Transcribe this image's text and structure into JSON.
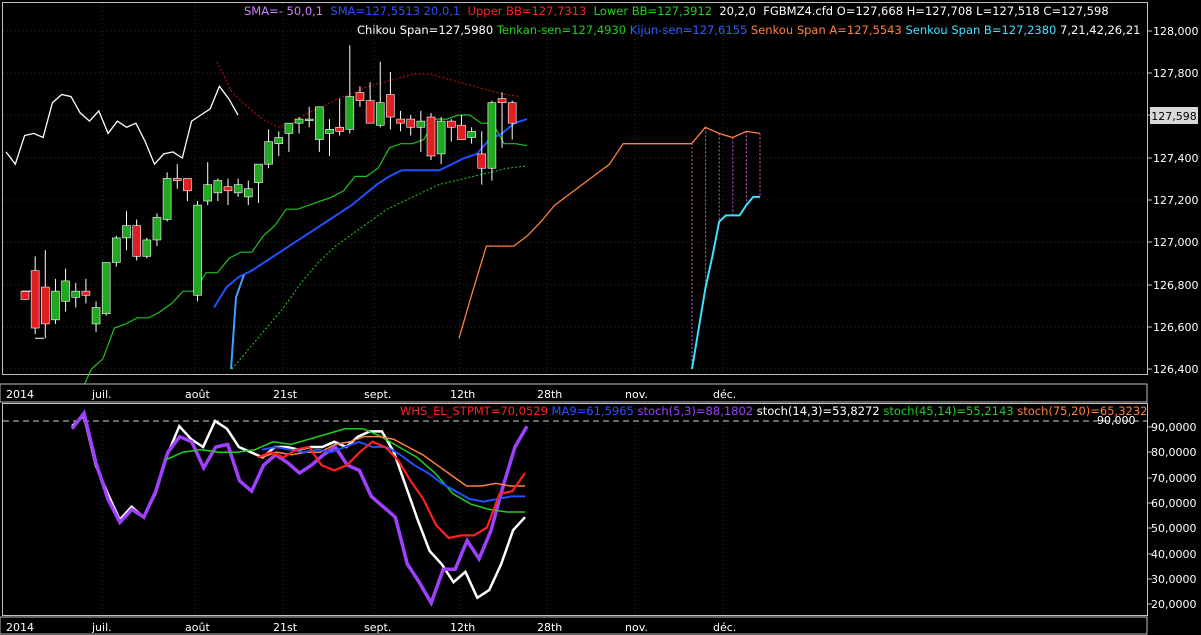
{
  "upper_panel": {
    "legend_row1": [
      {
        "text": "SMA=- 50,0,1",
        "color": "#d080ff"
      },
      {
        "text": "SMA=127,5513 20,0,1",
        "color": "#3050ff"
      },
      {
        "text": "Upper BB=127,7313",
        "color": "#ff2020"
      },
      {
        "text": "Lower BB=127,3912",
        "color": "#20d020"
      },
      {
        "text": "20,2,0",
        "color": "#ffffff"
      },
      {
        "text": "FGBMZ4.cfd O=127,668 H=127,708 L=127,518 C=127,598",
        "color": "#ffffff"
      }
    ],
    "legend_row2": [
      {
        "text": "Chikou Span=127,5980",
        "color": "#ffffff"
      },
      {
        "text": "Tenkan-sen=127,4930",
        "color": "#20d020"
      },
      {
        "text": "Kijun-sen=127,6155",
        "color": "#3060ff"
      },
      {
        "text": "Senkou Span A=127,5543",
        "color": "#ff8040"
      },
      {
        "text": "Senkou Span B=127,2380",
        "color": "#40e0ff"
      },
      {
        "text": "7,21,42,26,21",
        "color": "#ffffff"
      }
    ],
    "y_ticks": [
      "128,000",
      "127,800",
      "127,600",
      "127,400",
      "127,200",
      "127,000",
      "126,800",
      "126,600",
      "126,400"
    ],
    "last_price": "127,598",
    "x_ticks": [
      "2014",
      "juil.",
      "août",
      "21st",
      "sept.",
      "12th",
      "28th",
      "nov.",
      "déc."
    ]
  },
  "lower_panel": {
    "legend": [
      {
        "text": "WHS_EL_STPMT=70,0529",
        "color": "#ff2020"
      },
      {
        "text": "MA9=61,5965",
        "color": "#3050ff"
      },
      {
        "text": "stoch(5,3)=88,1802",
        "color": "#a040ff"
      },
      {
        "text": "stoch(14,3)=53,8272",
        "color": "#ffffff"
      },
      {
        "text": "stoch(45,14)=55,2143",
        "color": "#20d020"
      },
      {
        "text": "stoch(75,20)=65,3232",
        "color": "#ff8040"
      }
    ],
    "level_label": "90,000",
    "y_ticks": [
      "90,0000",
      "80,0000",
      "70,0000",
      "60,0000",
      "50,0000",
      "40,0000",
      "30,0000",
      "20,0000"
    ],
    "x_ticks": [
      "2014",
      "juil.",
      "août",
      "21st",
      "sept.",
      "12th",
      "28th",
      "nov.",
      "déc."
    ]
  },
  "chart_data": {
    "type": "line",
    "instrument": "FGBMZ4.cfd",
    "upper": {
      "ylim": [
        126.4,
        128.05
      ],
      "candles_ohlc": [
        [
          126.78,
          126.78,
          126.74,
          126.74
        ],
        [
          126.88,
          126.95,
          126.57,
          126.6
        ],
        [
          126.8,
          126.98,
          126.55,
          126.62
        ],
        [
          126.64,
          126.84,
          126.62,
          126.78
        ],
        [
          126.73,
          126.89,
          126.68,
          126.83
        ],
        [
          126.75,
          126.82,
          126.7,
          126.78
        ],
        [
          126.78,
          126.84,
          126.72,
          126.76
        ],
        [
          126.62,
          126.73,
          126.58,
          126.7
        ],
        [
          126.67,
          126.92,
          126.66,
          126.92
        ],
        [
          126.92,
          127.05,
          126.9,
          127.04
        ],
        [
          127.04,
          127.17,
          126.98,
          127.1
        ],
        [
          127.1,
          127.13,
          126.93,
          126.95
        ],
        [
          126.95,
          127.04,
          126.94,
          127.03
        ],
        [
          127.03,
          127.16,
          127.0,
          127.14
        ],
        [
          127.13,
          127.36,
          127.12,
          127.33
        ],
        [
          127.33,
          127.4,
          127.28,
          127.32
        ],
        [
          127.33,
          127.33,
          127.22,
          127.27
        ],
        [
          126.76,
          127.22,
          126.73,
          127.2
        ],
        [
          127.22,
          127.41,
          127.2,
          127.3
        ],
        [
          127.26,
          127.33,
          127.22,
          127.32
        ],
        [
          127.29,
          127.33,
          127.2,
          127.27
        ],
        [
          127.26,
          127.33,
          127.24,
          127.3
        ],
        [
          127.24,
          127.32,
          127.2,
          127.28
        ],
        [
          127.31,
          127.4,
          127.21,
          127.4
        ],
        [
          127.4,
          127.57,
          127.38,
          127.51
        ],
        [
          127.5,
          127.56,
          127.44,
          127.53
        ],
        [
          127.55,
          127.6,
          127.46,
          127.6
        ],
        [
          127.6,
          127.63,
          127.55,
          127.62
        ],
        [
          127.62,
          127.68,
          127.58,
          127.62
        ],
        [
          127.52,
          127.68,
          127.46,
          127.68
        ],
        [
          127.55,
          127.62,
          127.44,
          127.57
        ],
        [
          127.58,
          127.72,
          127.54,
          127.56
        ],
        [
          127.57,
          127.98,
          127.55,
          127.73
        ],
        [
          127.75,
          127.78,
          127.68,
          127.71
        ],
        [
          127.71,
          127.8,
          127.63,
          127.6
        ],
        [
          127.59,
          127.9,
          127.58,
          127.7
        ],
        [
          127.74,
          127.85,
          127.57,
          127.63
        ],
        [
          127.62,
          127.66,
          127.56,
          127.6
        ],
        [
          127.62,
          127.64,
          127.54,
          127.58
        ],
        [
          127.58,
          127.66,
          127.46,
          127.61
        ],
        [
          127.63,
          127.65,
          127.42,
          127.44
        ],
        [
          127.45,
          127.63,
          127.4,
          127.61
        ],
        [
          127.61,
          127.62,
          127.51,
          127.58
        ],
        [
          127.59,
          127.64,
          127.52,
          127.52
        ],
        [
          127.53,
          127.58,
          127.5,
          127.56
        ],
        [
          127.45,
          127.56,
          127.3,
          127.38
        ],
        [
          127.38,
          127.71,
          127.32,
          127.7
        ],
        [
          127.72,
          127.75,
          127.48,
          127.7
        ],
        [
          127.7,
          127.71,
          127.52,
          127.6
        ]
      ],
      "series": [
        {
          "name": "Chikou Span",
          "values": [
            127.46,
            127.4,
            127.54,
            127.55,
            127.53,
            127.7,
            127.74,
            127.73,
            127.65,
            127.61,
            127.66,
            127.55,
            127.61,
            127.58,
            127.6,
            127.51,
            127.4,
            127.45,
            127.46,
            127.43,
            127.61,
            127.64,
            127.67,
            127.78,
            127.72,
            127.64
          ]
        },
        {
          "name": "Tenkan-sen",
          "values": [
            126.28,
            126.4,
            126.45,
            126.6,
            126.62,
            126.65,
            126.65,
            126.68,
            126.72,
            126.78,
            126.78,
            126.87,
            126.87,
            126.94,
            126.97,
            126.97,
            127.05,
            127.1,
            127.18,
            127.18,
            127.2,
            127.22,
            127.24,
            127.27,
            127.34,
            127.34,
            127.38,
            127.48,
            127.5,
            127.5,
            127.52,
            127.62,
            127.62,
            127.64,
            127.64,
            127.6,
            127.6,
            127.5,
            127.5,
            127.49
          ]
        },
        {
          "name": "Kijun-sen",
          "values": [
            126.7,
            126.8,
            126.85,
            126.88,
            126.92,
            126.96,
            127.0,
            127.04,
            127.08,
            127.12,
            127.16,
            127.2,
            127.25,
            127.3,
            127.34,
            127.37,
            127.37,
            127.37,
            127.37,
            127.4,
            127.43,
            127.45,
            127.52,
            127.55,
            127.6,
            127.62
          ]
        },
        {
          "name": "Upper BB",
          "values": [
            127.9,
            127.75,
            127.68,
            127.62,
            127.58,
            127.6,
            127.65,
            127.68,
            127.72,
            127.75,
            127.78,
            127.8,
            127.82,
            127.84,
            127.84,
            127.82,
            127.8,
            127.78,
            127.76,
            127.74,
            127.73
          ]
        },
        {
          "name": "Lower BB",
          "values": [
            126.4,
            126.5,
            126.6,
            126.7,
            126.82,
            126.92,
            127.0,
            127.06,
            127.12,
            127.18,
            127.22,
            127.26,
            127.3,
            127.32,
            127.34,
            127.36,
            127.38,
            127.39
          ]
        },
        {
          "name": "Senkou Span A",
          "values": [
            126.55,
            126.78,
            127.0,
            127.0,
            127.0,
            127.05,
            127.12,
            127.2,
            127.25,
            127.3,
            127.35,
            127.4,
            127.5,
            127.5,
            127.5,
            127.5,
            127.5,
            127.5,
            127.58,
            127.55,
            127.53,
            127.56,
            127.55
          ]
        },
        {
          "name": "Senkou Span B",
          "values": [
            126.4,
            126.6,
            126.8,
            126.95,
            127.12,
            127.15,
            127.15,
            127.15,
            127.2,
            127.24,
            127.24
          ]
        }
      ]
    },
    "lower": {
      "ylim": [
        16,
        96
      ],
      "series": [
        {
          "name": "stoch(14,3)",
          "values": [
            88,
            92,
            73,
            62,
            52,
            57,
            53,
            62,
            77,
            88,
            83,
            80,
            90,
            87,
            80,
            78,
            76,
            80,
            80,
            79,
            80,
            80,
            82,
            80,
            84,
            86,
            86,
            78,
            65,
            52,
            40,
            35,
            28,
            32,
            22,
            25,
            35,
            48,
            53
          ]
        },
        {
          "name": "stoch(5,3)",
          "values": [
            87,
            93,
            74,
            60,
            51,
            56,
            53,
            63,
            78,
            84,
            82,
            72,
            80,
            81,
            67,
            63,
            73,
            77,
            74,
            70,
            73,
            77,
            80,
            73,
            71,
            61,
            57,
            53,
            35,
            28,
            20,
            33,
            33,
            44,
            37,
            48,
            65,
            80,
            88
          ]
        },
        {
          "name": "stoch(45,14)",
          "values": [
            75,
            78,
            79,
            78,
            78,
            79,
            82,
            81,
            83,
            85,
            87,
            87,
            84,
            80,
            76,
            70,
            62,
            58,
            56,
            55,
            55
          ]
        },
        {
          "name": "stoch(75,20)",
          "values": [
            76,
            78,
            77,
            78,
            78,
            81,
            82,
            84,
            84,
            83,
            80,
            77,
            73,
            69,
            65,
            65,
            66,
            65,
            65
          ]
        },
        {
          "name": "MA9",
          "values": [
            79,
            80,
            79,
            78,
            79,
            78,
            80,
            82,
            80,
            80,
            77,
            73,
            70,
            66,
            63,
            60,
            59,
            60,
            61,
            61
          ]
        },
        {
          "name": "WHS_EL_STPMT",
          "values": [
            76,
            78,
            76,
            79,
            80,
            73,
            71,
            73,
            78,
            82,
            80,
            75,
            67,
            60,
            50,
            45,
            46,
            46,
            49,
            62,
            63,
            70
          ]
        }
      ]
    }
  }
}
